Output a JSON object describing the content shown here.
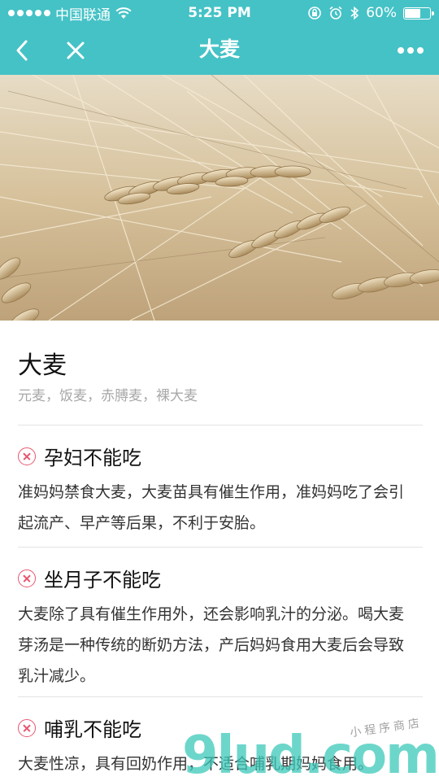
{
  "status_bar": {
    "carrier": "中国联通",
    "time": "5:25 PM",
    "battery_text": "60%",
    "battery_level": 0.6
  },
  "nav": {
    "title": "大麦",
    "back_icon": "chevron-left-icon",
    "close_icon": "close-icon",
    "more_icon": "more-icon"
  },
  "hero": {
    "image": "barley-field-photo"
  },
  "food": {
    "name": "大麦",
    "aliases": "元麦，饭麦，赤膊麦，裸大麦"
  },
  "sections": [
    {
      "title": "孕妇不能吃",
      "text": "准妈妈禁食大麦，大麦苗具有催生作用，准妈妈吃了会引起流产、早产等后果，不利于安胎。"
    },
    {
      "title": "坐月子不能吃",
      "text": "大麦除了具有催生作用外，还会影响乳汁的分泌。喝大麦芽汤是一种传统的断奶方法，产后妈妈食用大麦后会导致乳汁减少。"
    },
    {
      "title": "哺乳不能吃",
      "text": "大麦性凉，具有回奶作用，不适合哺乳期妈妈食用。"
    }
  ],
  "watermark": {
    "brand": "9lud.com",
    "tagline": "小程序商店"
  },
  "colors": {
    "accent": "#45c2c6",
    "warning_icon": "#e8556e",
    "muted_text": "#a8a8a8"
  }
}
